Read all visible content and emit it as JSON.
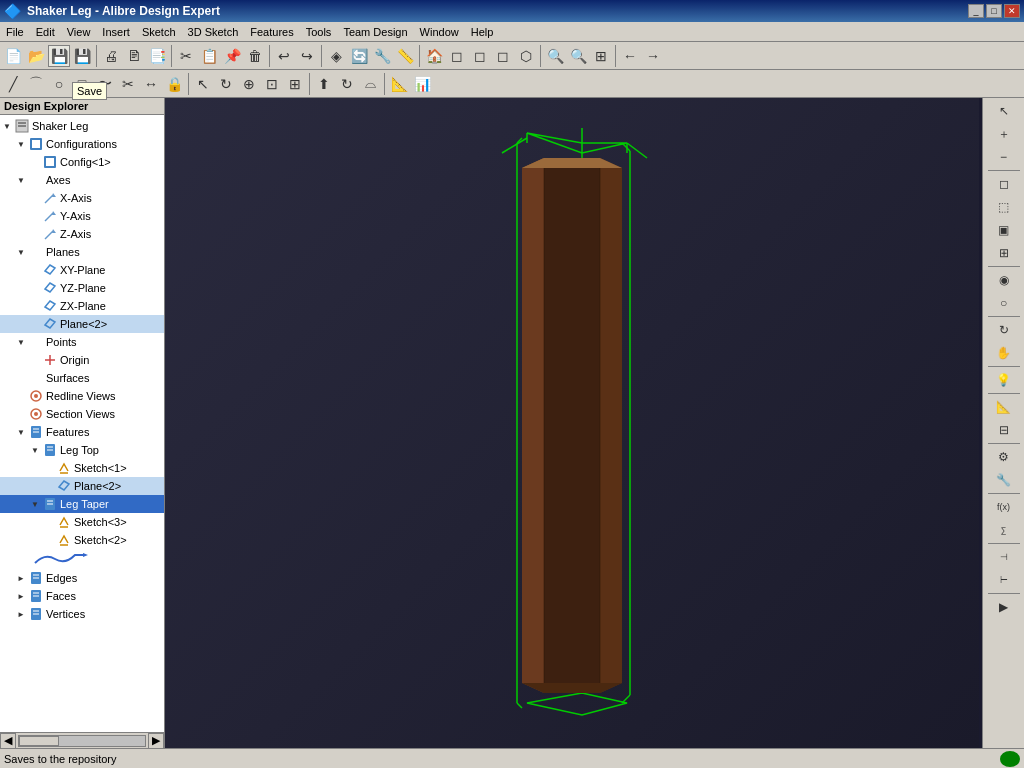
{
  "titleBar": {
    "title": "Shaker Leg - Alibre Design Expert",
    "appIcon": "🔷"
  },
  "menuBar": {
    "items": [
      "File",
      "Edit",
      "View",
      "Insert",
      "Sketch",
      "3D Sketch",
      "Features",
      "Tools",
      "Team Design",
      "Window",
      "Help"
    ]
  },
  "panelHeader": "Design Explorer",
  "tree": {
    "nodes": [
      {
        "id": "shaker-leg",
        "label": "Shaker Leg",
        "indent": 0,
        "expand": "▼",
        "icon": "📄",
        "selected": false
      },
      {
        "id": "configurations",
        "label": "Configurations",
        "indent": 1,
        "expand": "▼",
        "icon": "⚙",
        "selected": false
      },
      {
        "id": "config1",
        "label": "Config<1>",
        "indent": 2,
        "expand": "",
        "icon": "⚙",
        "selected": false
      },
      {
        "id": "axes",
        "label": "Axes",
        "indent": 1,
        "expand": "▼",
        "icon": "",
        "selected": false
      },
      {
        "id": "x-axis",
        "label": "X-Axis",
        "indent": 2,
        "expand": "",
        "icon": "↗",
        "selected": false
      },
      {
        "id": "y-axis",
        "label": "Y-Axis",
        "indent": 2,
        "expand": "",
        "icon": "↗",
        "selected": false
      },
      {
        "id": "z-axis",
        "label": "Z-Axis",
        "indent": 2,
        "expand": "",
        "icon": "↗",
        "selected": false
      },
      {
        "id": "planes",
        "label": "Planes",
        "indent": 1,
        "expand": "▼",
        "icon": "",
        "selected": false
      },
      {
        "id": "xy-plane",
        "label": "XY-Plane",
        "indent": 2,
        "expand": "",
        "icon": "🔷",
        "selected": false
      },
      {
        "id": "yz-plane",
        "label": "YZ-Plane",
        "indent": 2,
        "expand": "",
        "icon": "🔷",
        "selected": false
      },
      {
        "id": "zx-plane",
        "label": "ZX-Plane",
        "indent": 2,
        "expand": "",
        "icon": "🔷",
        "selected": false
      },
      {
        "id": "plane2",
        "label": "Plane<2>",
        "indent": 2,
        "expand": "",
        "icon": "🔷",
        "selected": false,
        "highlighted": true
      },
      {
        "id": "points",
        "label": "Points",
        "indent": 1,
        "expand": "▼",
        "icon": "",
        "selected": false
      },
      {
        "id": "origin",
        "label": "Origin",
        "indent": 2,
        "expand": "",
        "icon": "✕",
        "selected": false
      },
      {
        "id": "surfaces",
        "label": "Surfaces",
        "indent": 1,
        "expand": "",
        "icon": "",
        "selected": false
      },
      {
        "id": "redline-views",
        "label": "Redline Views",
        "indent": 1,
        "expand": "",
        "icon": "👁",
        "selected": false
      },
      {
        "id": "section-views",
        "label": "Section Views",
        "indent": 1,
        "expand": "",
        "icon": "👁",
        "selected": false
      },
      {
        "id": "features",
        "label": "Features",
        "indent": 1,
        "expand": "▼",
        "icon": "📁",
        "selected": false
      },
      {
        "id": "leg-top",
        "label": "Leg Top",
        "indent": 2,
        "expand": "▼",
        "icon": "📁",
        "selected": false
      },
      {
        "id": "sketch1",
        "label": "Sketch<1>",
        "indent": 3,
        "expand": "",
        "icon": "✏",
        "selected": false
      },
      {
        "id": "plane2b",
        "label": "Plane<2>",
        "indent": 3,
        "expand": "",
        "icon": "🔷",
        "selected": false,
        "highlighted": true
      },
      {
        "id": "leg-taper",
        "label": "Leg Taper",
        "indent": 2,
        "expand": "▼",
        "icon": "📁",
        "selected": true
      },
      {
        "id": "sketch3",
        "label": "Sketch<3>",
        "indent": 3,
        "expand": "",
        "icon": "✏",
        "selected": false
      },
      {
        "id": "sketch2",
        "label": "Sketch<2>",
        "indent": 3,
        "expand": "",
        "icon": "✏",
        "selected": false
      },
      {
        "id": "edges",
        "label": "Edges",
        "indent": 1,
        "expand": "►",
        "icon": "📁",
        "selected": false
      },
      {
        "id": "faces",
        "label": "Faces",
        "indent": 1,
        "expand": "►",
        "icon": "📁",
        "selected": false
      },
      {
        "id": "vertices",
        "label": "Vertices",
        "indent": 1,
        "expand": "►",
        "icon": "📁",
        "selected": false
      }
    ]
  },
  "statusBar": {
    "text": "Saves to the repository"
  },
  "rightToolbar": {
    "icons": [
      "↖",
      "↻",
      "⊕",
      "⊖",
      "◻",
      "⬚",
      "✦",
      "—",
      "🔲",
      "🔳",
      "◎",
      "⟳",
      "↔",
      "↕",
      "⚡",
      "🔧",
      "📐",
      "⚙",
      "⊕",
      "✦",
      "⬡",
      "⬢",
      "◈",
      "🔩"
    ]
  },
  "saveTooltip": "Save",
  "viewport": {
    "bgColor": "#1a1a2a"
  }
}
